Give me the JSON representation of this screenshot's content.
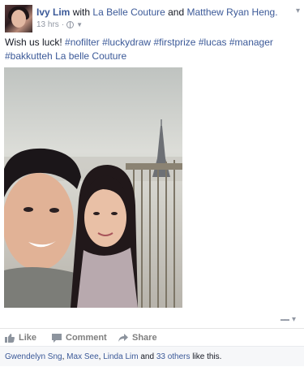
{
  "post": {
    "author": "Ivy Lim",
    "with_text": "with",
    "tagged_page": "La Belle Couture",
    "and_text": "and",
    "tagged_person": "Matthew Ryan Heng.",
    "timestamp": "13 hrs",
    "separator": "·",
    "audience_icon": "globe-icon",
    "status_prefix": "Wish us luck!",
    "hashtags": [
      "#nofilter",
      "#luckydraw",
      "#firstprize",
      "#lucas",
      "#manager",
      "#bakkutteh"
    ],
    "status_suffix": "La belle Couture"
  },
  "actions": {
    "like": "Like",
    "comment": "Comment",
    "share": "Share"
  },
  "likes_bar": {
    "names": [
      "Gwendelyn Sng",
      "Max See",
      "Linda Lim"
    ],
    "and_text": "and",
    "others": "33 others",
    "suffix": "like this."
  },
  "colors": {
    "link": "#3b5998",
    "muted": "#9197a3",
    "action": "#7f7f7f"
  }
}
